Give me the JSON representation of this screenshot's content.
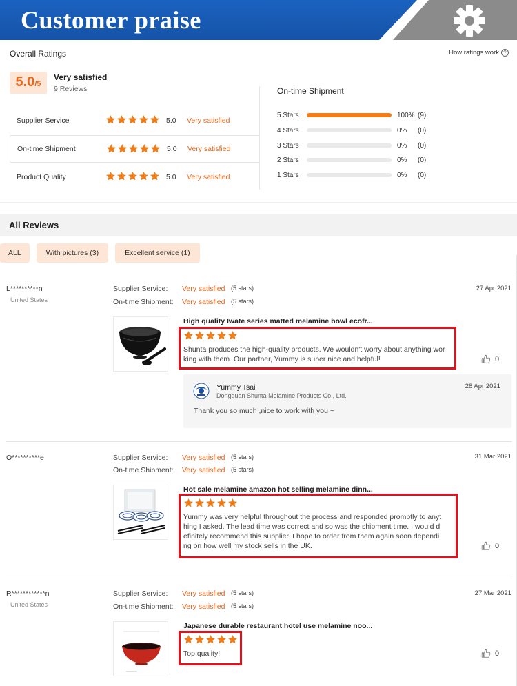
{
  "banner": {
    "title": "Customer praise",
    "gear_icon": "gear-icon"
  },
  "overall": {
    "title": "Overall Ratings",
    "how_link": "How ratings work",
    "score": "5.0",
    "score_max": "/5",
    "verdict": "Very satisfied",
    "reviews_count": "9 Reviews",
    "categories": [
      {
        "name": "Supplier Service",
        "rating": 5,
        "score": "5.0",
        "text": "Very satisfied"
      },
      {
        "name": "On-time Shipment",
        "rating": 5,
        "score": "5.0",
        "text": "Very satisfied"
      },
      {
        "name": "Product Quality",
        "rating": 5,
        "score": "5.0",
        "text": "Very satisfied"
      }
    ]
  },
  "distribution": {
    "title": "On-time Shipment",
    "rows": [
      {
        "label": "5 Stars",
        "fraction": 1.0,
        "pct": "100%",
        "count": "(9)"
      },
      {
        "label": "4 Stars",
        "fraction": 0,
        "pct": "0%",
        "count": "(0)"
      },
      {
        "label": "3 Stars",
        "fraction": 0,
        "pct": "0%",
        "count": "(0)"
      },
      {
        "label": "2 Stars",
        "fraction": 0,
        "pct": "0%",
        "count": "(0)"
      },
      {
        "label": "1 Stars",
        "fraction": 0,
        "pct": "0%",
        "count": "(0)"
      }
    ]
  },
  "all_reviews": {
    "title": "All Reviews"
  },
  "filters": [
    "ALL",
    "With pictures (3)",
    "Excellent service (1)"
  ],
  "reviews": [
    {
      "name": "L**********n",
      "country": "United States",
      "date": "27 Apr 2021",
      "supplier_key": "Supplier Service:",
      "supplier_val": "Very satisfied",
      "supplier_stars": "(5 stars)",
      "shipment_key": "On-time Shipment:",
      "shipment_val": "Very satisfied",
      "shipment_stars": "(5 stars)",
      "product": "High quality Iwate series matted melamine bowl ecofr...",
      "rating": 5,
      "text_lines": [
        "Shunta produces the high-quality products. We wouldn't worry about anything wor",
        "king with them. Our partner, Yummy is super nice and helpful!"
      ],
      "likes": "0",
      "reply": {
        "name": "Yummy Tsai",
        "company": "Dongguan Shunta Melamine Products Co., Ltd.",
        "date": "28 Apr 2021",
        "text": "Thank you so much ,nice to work with you ~"
      }
    },
    {
      "name": "O**********e",
      "country": "",
      "date": "31 Mar 2021",
      "supplier_key": "Supplier Service:",
      "supplier_val": "Very satisfied",
      "supplier_stars": "(5 stars)",
      "shipment_key": "On-time Shipment:",
      "shipment_val": "Very satisfied",
      "shipment_stars": "(5 stars)",
      "product": "Hot sale melamine amazon hot selling melamine dinn...",
      "rating": 5,
      "text_lines": [
        "Yummy was very helpful throughout the process and responded promptly to anyt",
        "hing I asked.  The lead time was correct and so was the shipment time.  I would d",
        "efinitely recommend this supplier.  I hope to order from them again soon dependi",
        "ng on how well my stock sells in the UK."
      ],
      "likes": "0"
    },
    {
      "name": "R************n",
      "country": "United States",
      "date": "27 Mar 2021",
      "supplier_key": "Supplier Service:",
      "supplier_val": "Very satisfied",
      "supplier_stars": "(5 stars)",
      "shipment_key": "On-time Shipment:",
      "shipment_val": "Very satisfied",
      "shipment_stars": "(5 stars)",
      "product": "Japanese durable restaurant hotel use melamine noo...",
      "rating": 5,
      "text_lines": [
        "Top quality!"
      ],
      "likes": "0"
    }
  ],
  "colors": {
    "accent": "#e8651a",
    "banner_blue": "#1553a8",
    "highlight_red": "#e0121b",
    "chip_bg": "#fde6d5"
  }
}
